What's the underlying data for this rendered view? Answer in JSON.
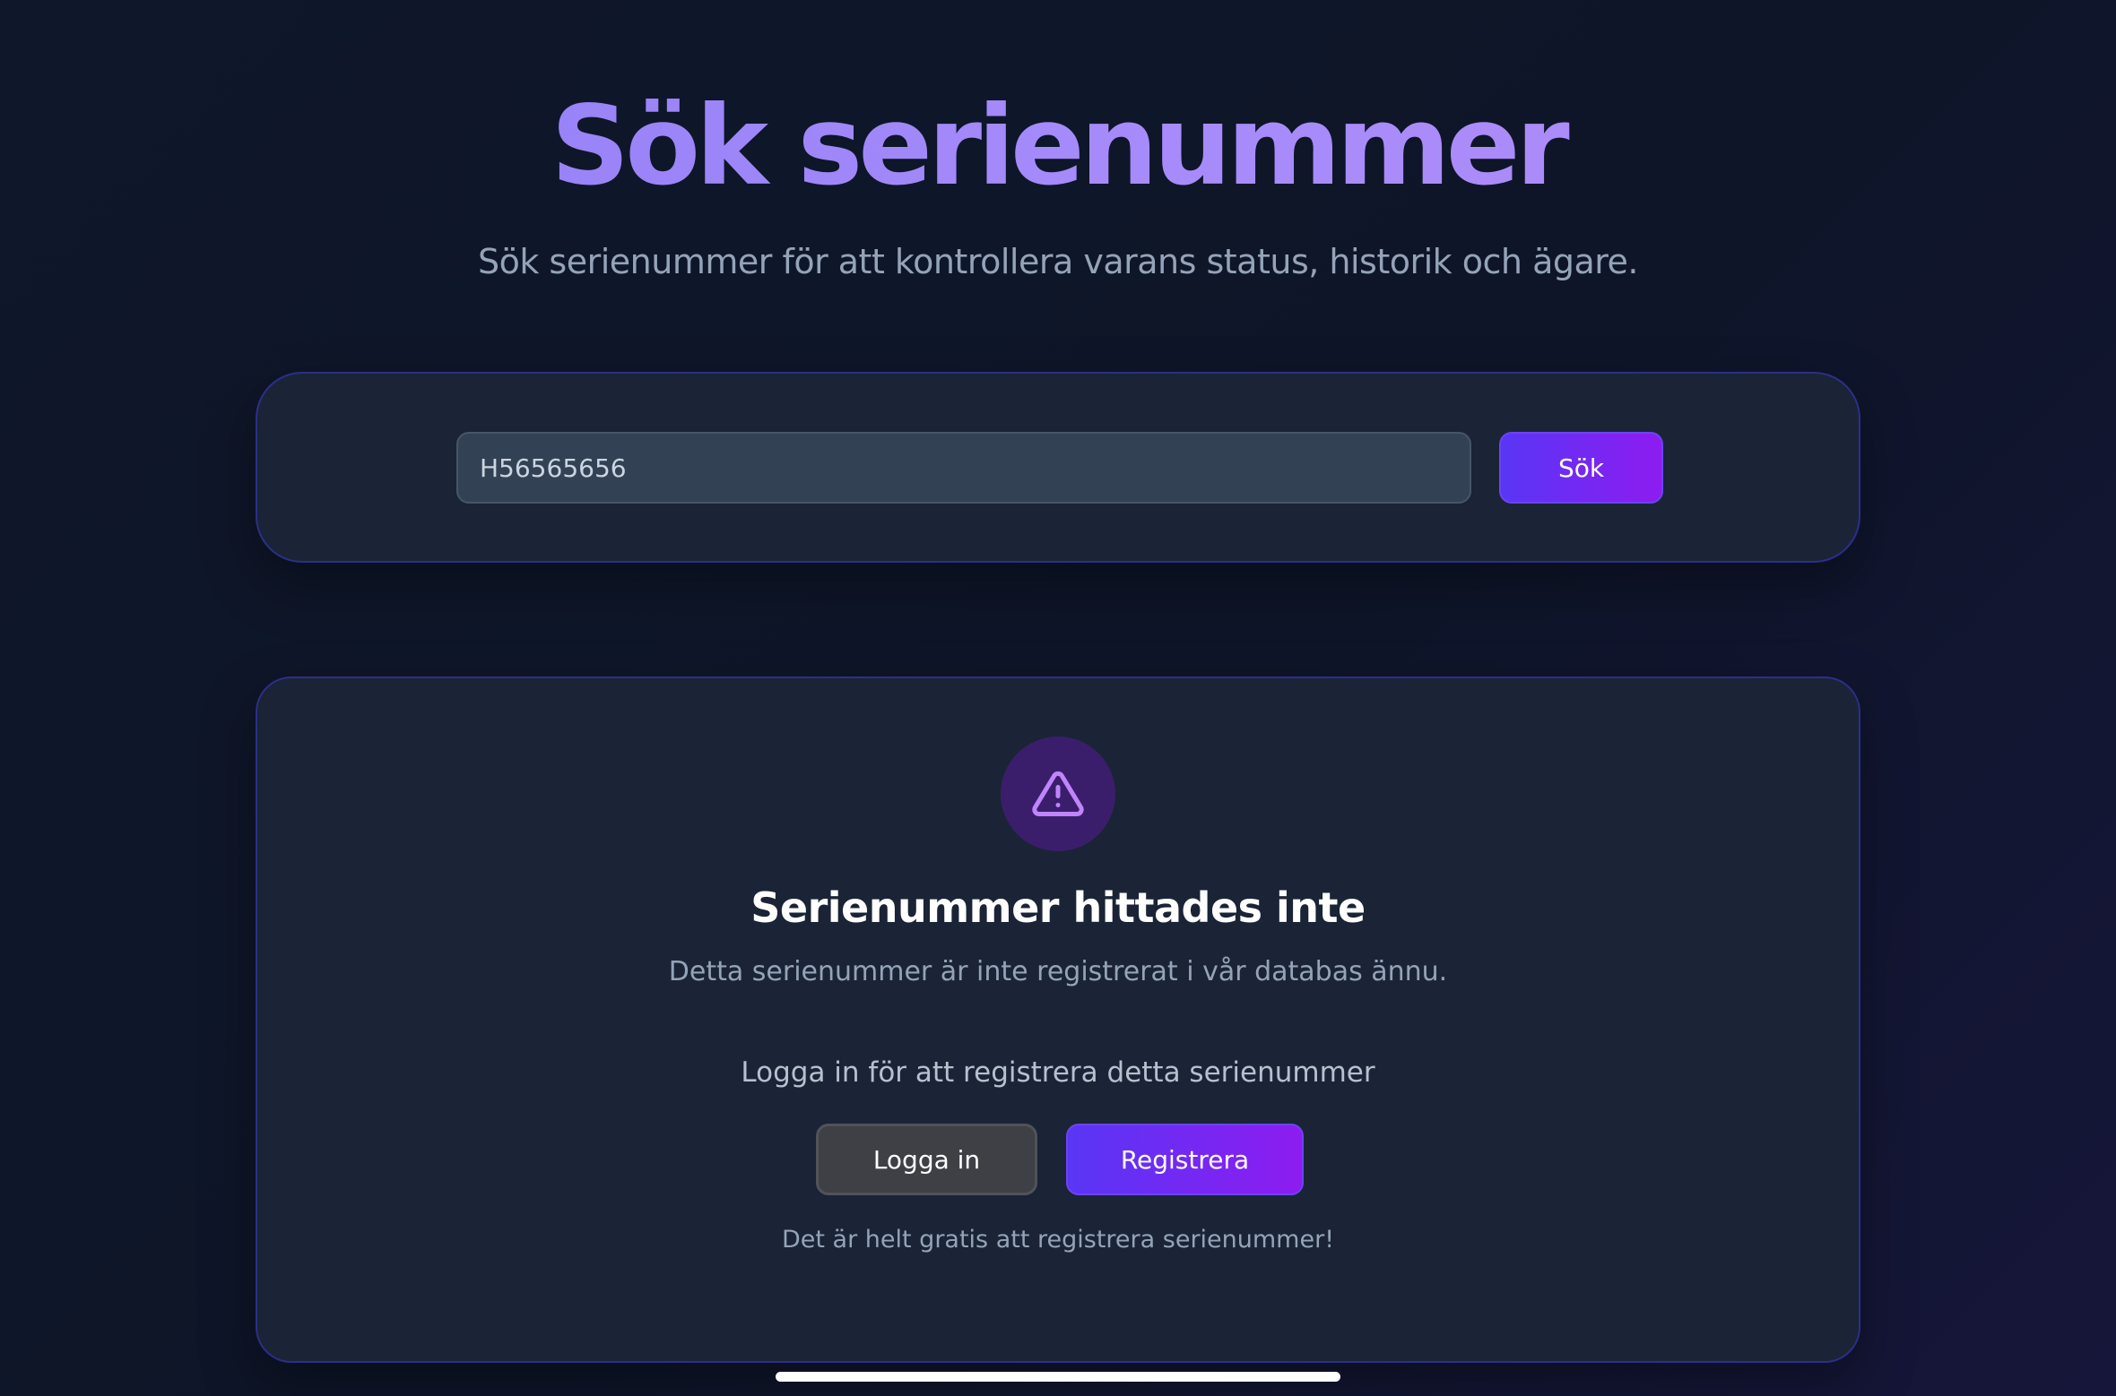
{
  "header": {
    "title": "Sök serienummer",
    "subtitle": "Sök serienummer för att kontrollera varans status, historik och ägare."
  },
  "search": {
    "value": "H56565656",
    "button_label": "Sök"
  },
  "result": {
    "icon": "warning-triangle-icon",
    "title": "Serienummer hittades inte",
    "description": "Detta serienummer är inte registrerat i vår databas ännu.",
    "login_prompt": "Logga in för att registrera detta serienummer",
    "login_label": "Logga in",
    "register_label": "Registrera",
    "note": "Det är helt gratis att registrera serienummer!"
  },
  "colors": {
    "accent": "#8b5cf6",
    "primary_gradient_start": "#5936f5",
    "primary_gradient_end": "#8d1cf0",
    "background": "#0f172a",
    "card": "#1a2436",
    "warning_icon": "#c084fc"
  }
}
